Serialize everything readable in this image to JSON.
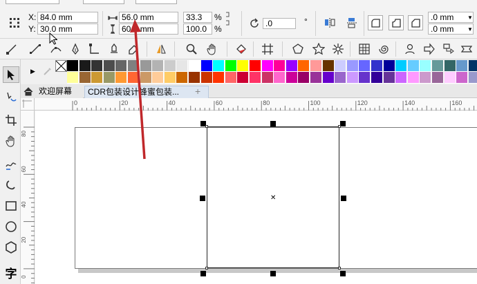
{
  "position": {
    "x_label": "X:",
    "x_value": "84.0 mm",
    "y_label": "Y:",
    "y_value": "30.0 mm"
  },
  "size": {
    "w_value": "56.0 mm",
    "h_value": "60.0 mm"
  },
  "scale": {
    "w_percent": "33.3",
    "h_percent": "100.0",
    "unit": "%"
  },
  "rotation": {
    "value": ".0",
    "degree_symbol": "°"
  },
  "outline": {
    "value_1": ".0 mm",
    "value_2": ".0 mm"
  },
  "tabs": [
    {
      "label": "欢迎屏幕"
    },
    {
      "label": "CDR包装设计蜂蜜包装..."
    }
  ],
  "new_tab_symbol": "+",
  "hruler_labels": [
    "0",
    "20",
    "40",
    "60",
    "80",
    "100",
    "120",
    "140",
    "160"
  ],
  "vruler_labels": [
    "80",
    "60",
    "40",
    "20",
    "0"
  ],
  "toolbox": {
    "text_tool_glyph": "字"
  },
  "annotation": {
    "arrow_color": "#c0282b"
  },
  "palette": {
    "row1": [
      "#000000",
      "#1a1a1a",
      "#333333",
      "#4d4d4d",
      "#666666",
      "#808080",
      "#999999",
      "#b3b3b3",
      "#cccccc",
      "#e6e6e6",
      "#ffffff",
      "#0000ff",
      "#00ffff",
      "#00ff00",
      "#ffff00",
      "#ff0000",
      "#ff00ff",
      "#ff0099",
      "#9900ff",
      "#ff6600",
      "#ff9999",
      "#663300",
      "#ccccff",
      "#9999ff",
      "#6666ff",
      "#3333cc",
      "#000099",
      "#00ccff",
      "#66ccff",
      "#99ffff",
      "#669999",
      "#336666",
      "#6699cc",
      "#003366"
    ],
    "row2": [
      "#ffff99",
      "#996633",
      "#cc9933",
      "#999966",
      "#ff9933",
      "#ff6633",
      "#cc9966",
      "#ffcc99",
      "#ffcc66",
      "#cc6600",
      "#993300",
      "#cc3300",
      "#ff3300",
      "#ff6666",
      "#cc0033",
      "#ff3366",
      "#cc3366",
      "#ff66cc",
      "#cc0099",
      "#990066",
      "#993399",
      "#6600cc",
      "#9966cc",
      "#cc99ff",
      "#6633cc",
      "#330099",
      "#663399",
      "#cc66ff",
      "#ff99ff",
      "#cc99cc",
      "#996699",
      "#ffccff",
      "#cc66cc",
      "#9999cc"
    ]
  }
}
